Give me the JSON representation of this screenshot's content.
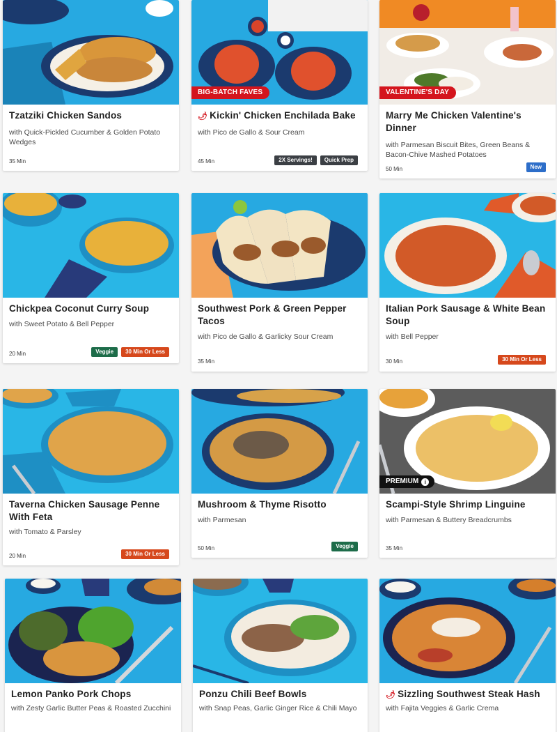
{
  "colors": {
    "page_bg": "#f4f4f4",
    "card_bg": "#ffffff",
    "ribbon_red": "#d4151d",
    "veggie_green": "#1d6c49",
    "quick_orange": "#d6481c",
    "tag_dark": "#3b3f44",
    "new_blue": "#2d6ec9",
    "photo_blue": "#27a9e1",
    "photo_gray": "#5a5a5a"
  },
  "recipes": [
    {
      "title": "Tzatziki Chicken Sandos",
      "subtitle": "with Quick-Pickled Cucumber & Golden Potato Wedges",
      "time": "35 Min",
      "tags": [],
      "ribbon": "",
      "spicy": false
    },
    {
      "title": "Kickin' Chicken Enchilada Bake",
      "subtitle": "with Pico de Gallo & Sour Cream",
      "time": "45 Min",
      "tags": [
        "2X Servings!",
        "Quick Prep"
      ],
      "ribbon": "BIG-BATCH FAVES",
      "spicy": true
    },
    {
      "title": "Marry Me Chicken Valentine's Dinner",
      "subtitle": "with Parmesan Biscuit Bites, Green Beans & Bacon-Chive Mashed Potatoes",
      "time": "50 Min",
      "tags": [
        "New"
      ],
      "ribbon": "VALENTINE'S DAY",
      "spicy": false
    },
    {
      "title": "Chickpea Coconut Curry Soup",
      "subtitle": "with Sweet Potato & Bell Pepper",
      "time": "20 Min",
      "tags": [
        "Veggie",
        "30 Min Or Less"
      ],
      "ribbon": "",
      "spicy": false
    },
    {
      "title": "Southwest Pork & Green Pepper Tacos",
      "subtitle": "with Pico de Gallo & Garlicky Sour Cream",
      "time": "35 Min",
      "tags": [],
      "ribbon": "",
      "spicy": false
    },
    {
      "title": "Italian Pork Sausage & White Bean Soup",
      "subtitle": "with Bell Pepper",
      "time": "30 Min",
      "tags": [
        "30 Min Or Less"
      ],
      "ribbon": "",
      "spicy": false
    },
    {
      "title": "Taverna Chicken Sausage Penne With Feta",
      "subtitle": "with Tomato & Parsley",
      "time": "20 Min",
      "tags": [
        "30 Min Or Less"
      ],
      "ribbon": "",
      "spicy": false
    },
    {
      "title": "Mushroom & Thyme Risotto",
      "subtitle": "with Parmesan",
      "time": "50 Min",
      "tags": [
        "Veggie"
      ],
      "ribbon": "",
      "spicy": false
    },
    {
      "title": "Scampi-Style Shrimp Linguine",
      "subtitle": "with Parmesan & Buttery Breadcrumbs",
      "time": "35 Min",
      "tags": [],
      "ribbon": "PREMIUM",
      "spicy": false
    },
    {
      "title": "Lemon Panko Pork Chops",
      "subtitle": "with Zesty Garlic Butter Peas & Roasted Zucchini",
      "time": "",
      "tags": [],
      "ribbon": "",
      "spicy": false
    },
    {
      "title": "Ponzu Chili Beef Bowls",
      "subtitle": "with Snap Peas, Garlic Ginger Rice & Chili Mayo",
      "time": "",
      "tags": [],
      "ribbon": "",
      "spicy": false
    },
    {
      "title": "Sizzling Southwest Steak Hash",
      "subtitle": "with Fajita Veggies & Garlic Crema",
      "time": "",
      "tags": [],
      "ribbon": "",
      "spicy": true
    }
  ]
}
